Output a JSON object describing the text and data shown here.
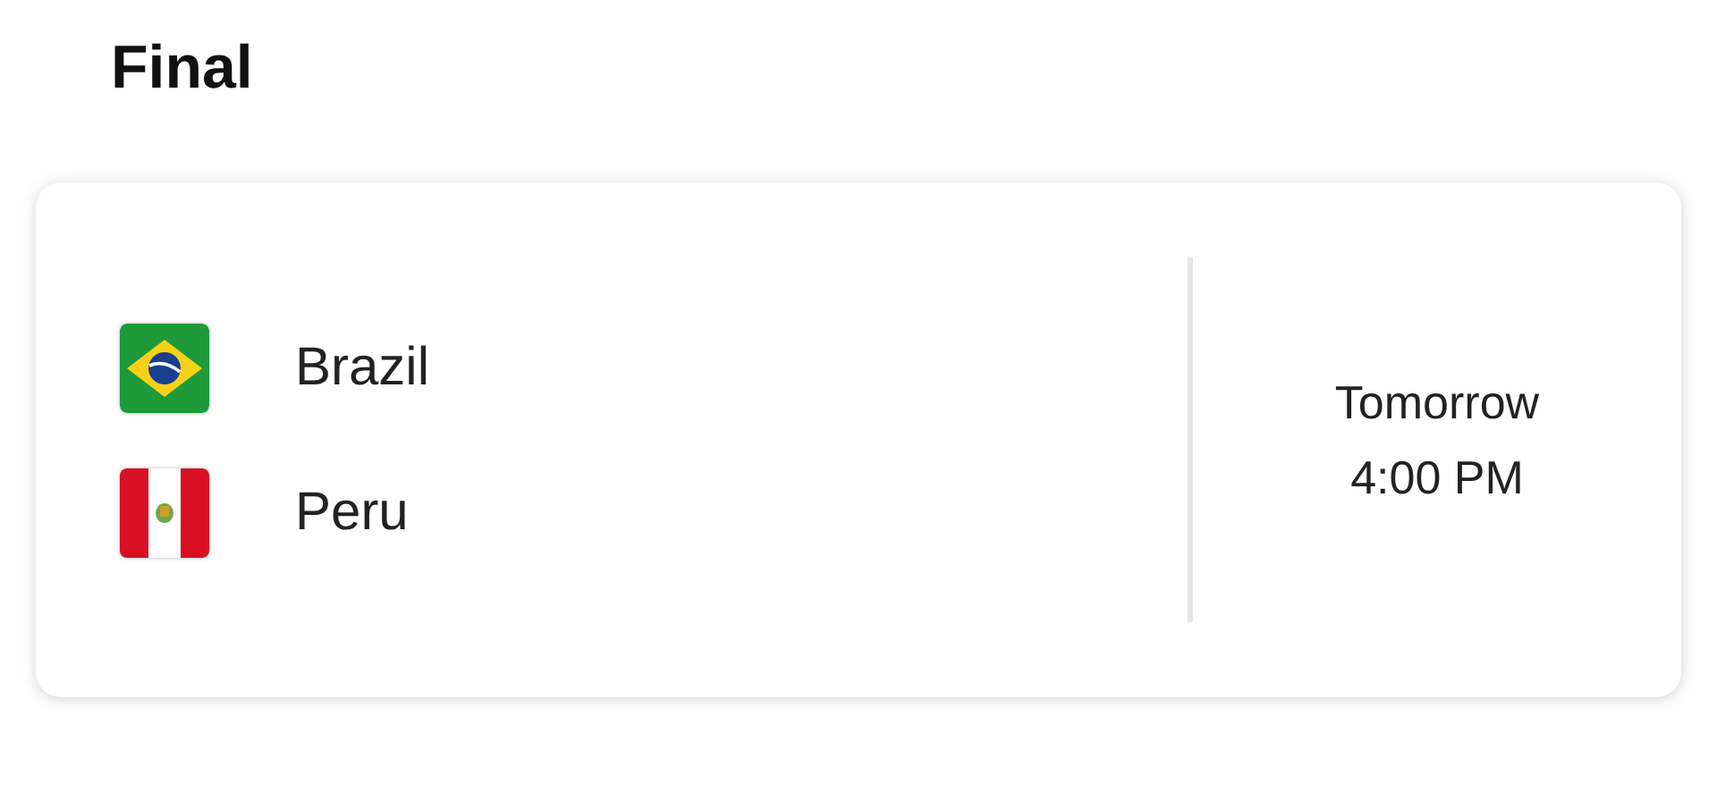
{
  "title": "Final",
  "match": {
    "teams": [
      {
        "name": "Brazil",
        "kind": "brazil"
      },
      {
        "name": "Peru",
        "kind": "peru"
      }
    ],
    "time_lines": [
      "Tomorrow",
      "4:00 PM"
    ]
  }
}
